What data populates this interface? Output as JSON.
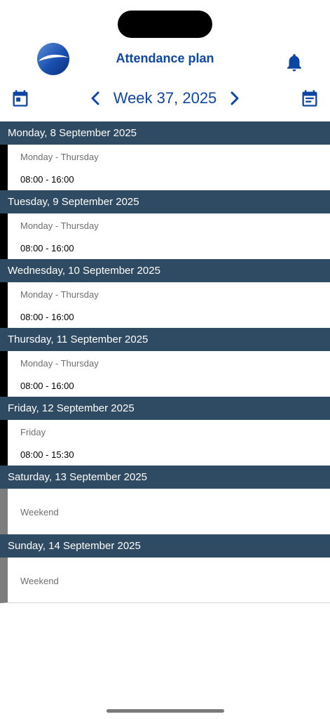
{
  "header": {
    "title": "Attendance plan"
  },
  "week_nav": {
    "label": "Week 37, 2025"
  },
  "days": [
    {
      "date": "Monday, 8 September 2025",
      "shift": "Monday - Thursday",
      "time": "08:00 - 16:00"
    },
    {
      "date": "Tuesday, 9 September 2025",
      "shift": "Monday - Thursday",
      "time": "08:00 - 16:00"
    },
    {
      "date": "Wednesday, 10 September 2025",
      "shift": "Monday - Thursday",
      "time": "08:00 - 16:00"
    },
    {
      "date": "Thursday, 11 September 2025",
      "shift": "Monday - Thursday",
      "time": "08:00 - 16:00"
    },
    {
      "date": "Friday, 12 September 2025",
      "shift": "Friday",
      "time": "08:00 - 15:30"
    },
    {
      "date": "Saturday, 13 September 2025",
      "status": "Weekend"
    },
    {
      "date": "Sunday, 14 September 2025",
      "status": "Weekend"
    }
  ],
  "icons": {
    "logo": "app-logo",
    "notifications": "bell-icon",
    "calendar_today": "calendar-icon",
    "calendar_list": "calendar-list-icon",
    "previous_week": "chevron-left-icon",
    "next_week": "chevron-right-icon"
  },
  "colors": {
    "primary": "#0d47a1",
    "day_header_bg": "#2f4a63",
    "workday_bar": "#000000",
    "weekend_bar": "#7d7d7d"
  }
}
